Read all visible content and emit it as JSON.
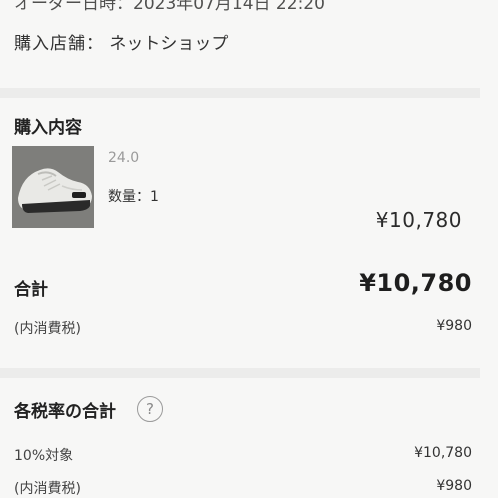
{
  "header": {
    "order_datetime_clipped": "オーダー日時：2023年07月14日 22:20"
  },
  "store": {
    "label": "購入店舗：",
    "value": "ネットショップ"
  },
  "purchase": {
    "title": "購入内容",
    "item": {
      "image_icon": "sneaker-photo",
      "size": "24.0",
      "quantity_label": "数量：",
      "quantity": "1",
      "price": "¥10,780"
    }
  },
  "totals": {
    "total_label": "合計",
    "total_value": "¥10,780",
    "tax_included_label": "(内消費税)",
    "tax_included_value": "¥980"
  },
  "tax_rates": {
    "title": "各税率の合計",
    "help_icon": "question-circle-icon",
    "help_glyph": "?",
    "rows": [
      {
        "label": "10%対象",
        "value": "¥10,780"
      },
      {
        "label": "(内消費税)",
        "value": "¥980"
      }
    ]
  },
  "colors": {
    "background": "#f7f7f6",
    "separator": "#ececeb",
    "muted_text": "#9a9a9a"
  }
}
